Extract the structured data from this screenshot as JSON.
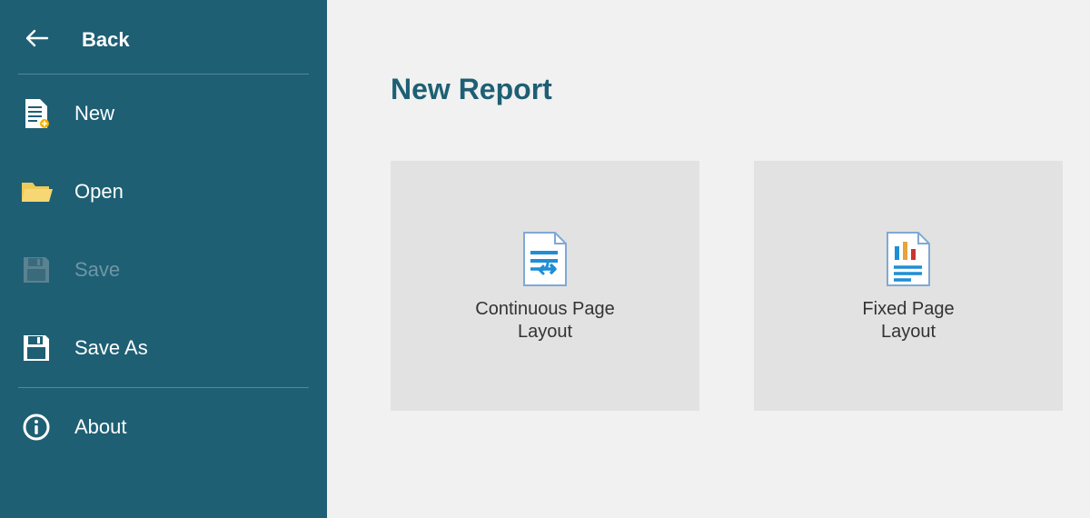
{
  "sidebar": {
    "back_label": "Back",
    "items": [
      {
        "label": "New",
        "disabled": false
      },
      {
        "label": "Open",
        "disabled": false
      },
      {
        "label": "Save",
        "disabled": true
      },
      {
        "label": "Save As",
        "disabled": false
      },
      {
        "label": "About",
        "disabled": false
      }
    ]
  },
  "main": {
    "title": "New Report",
    "cards": [
      {
        "label": "Continuous Page\nLayout"
      },
      {
        "label": "Fixed Page\nLayout"
      }
    ]
  },
  "colors": {
    "accent": "#1e5f74",
    "pagefold": "#7fa9d6",
    "bluefill": "#1f8ed6",
    "folder": "#f6d773",
    "save_disabled": "#5a8290"
  }
}
